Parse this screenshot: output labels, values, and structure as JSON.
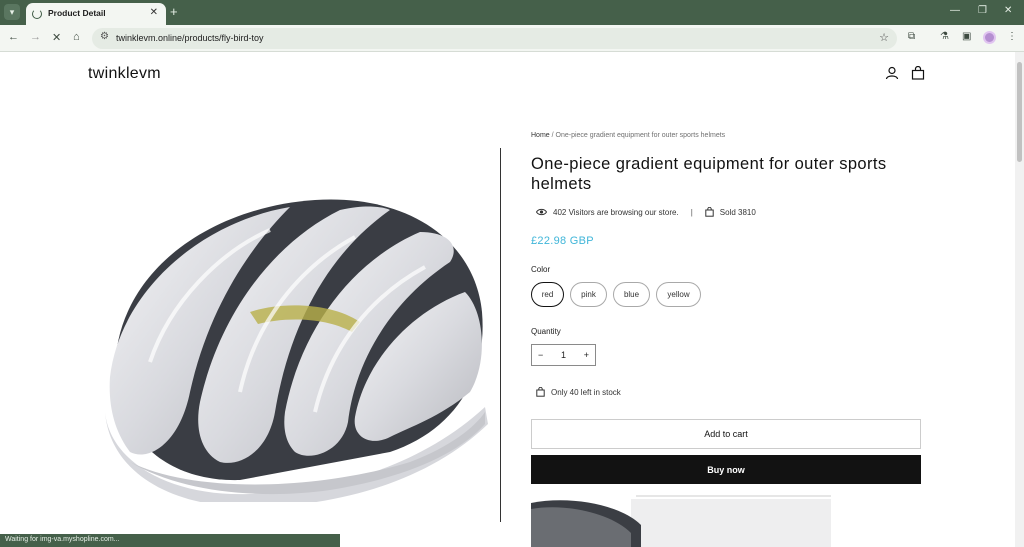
{
  "browser": {
    "tab_title": "Product Detail",
    "url": "twinklevm.online/products/fly-bird-toy",
    "new_tab_symbol": "+",
    "status_text": "Waiting for img-va.myshopline.com..."
  },
  "store": {
    "logo": "twinklevm"
  },
  "product": {
    "breadcrumb_home": "Home",
    "breadcrumb_sep": " / ",
    "breadcrumb_current": "One-piece gradient equipment for outer sports helmets",
    "title": "One-piece gradient equipment for outer sports helmets",
    "visitors_text": "402 Visitors are browsing our store.",
    "divider": "|",
    "sold_text": "Sold 3810",
    "price": "£22.98 GBP",
    "color_label": "Color",
    "colors": [
      "red",
      "pink",
      "blue",
      "yellow"
    ],
    "selected_color": "red",
    "quantity_label": "Quantity",
    "quantity_value": "1",
    "minus": "−",
    "plus": "+",
    "stock_text": "Only 40 left in stock",
    "add_to_cart": "Add to cart",
    "buy_now": "Buy now"
  },
  "colors": {
    "chrome_dark": "#45604a",
    "chrome_light": "#f3f6f2",
    "price": "#41b6d9",
    "button_dark": "#121212"
  },
  "icons": [
    "tab-search-icon",
    "loading-spinner-icon",
    "close-icon",
    "back-icon",
    "forward-icon",
    "stop-icon",
    "home-icon",
    "site-info-icon",
    "bookmark-star-icon",
    "extensions-icon",
    "labs-icon",
    "sidebar-icon",
    "kebab-menu-icon",
    "account-icon",
    "cart-icon",
    "eye-icon",
    "bag-icon"
  ]
}
